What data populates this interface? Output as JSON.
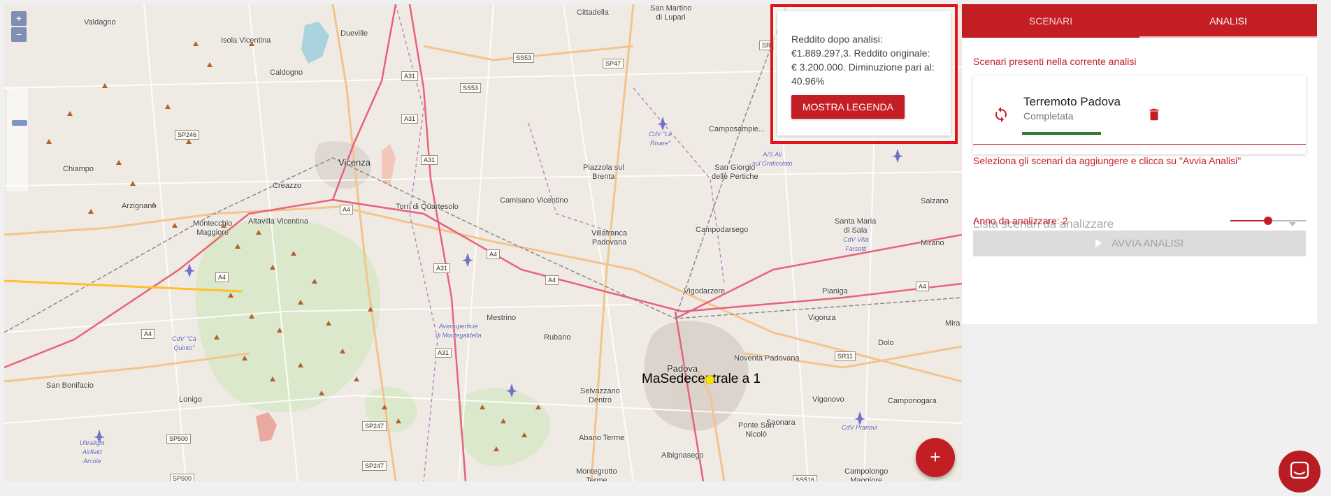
{
  "map": {
    "zoom_in": "+",
    "zoom_out": "−",
    "places": [
      {
        "id": "valdagno",
        "label": "Valdagno"
      },
      {
        "id": "isola-vicentina",
        "label": "Isola Vicentina"
      },
      {
        "id": "dueville",
        "label": "Dueville"
      },
      {
        "id": "caldogno",
        "label": "Caldogno"
      },
      {
        "id": "cittadella",
        "label": "Cittadella"
      },
      {
        "id": "san-martino",
        "label": "San Martino\ndi Lupari"
      },
      {
        "id": "chiampo",
        "label": "Chiampo"
      },
      {
        "id": "vicenza",
        "label": "Vicenza"
      },
      {
        "id": "creazzo",
        "label": "Creazzo"
      },
      {
        "id": "arzignano",
        "label": "Arzignano"
      },
      {
        "id": "montecchio",
        "label": "Montecchio\nMaggiore"
      },
      {
        "id": "altavilla",
        "label": "Altavilla Vicentina"
      },
      {
        "id": "torri",
        "label": "Torri di Quartesolo"
      },
      {
        "id": "camisano",
        "label": "Camisano Vicentino"
      },
      {
        "id": "piazzola",
        "label": "Piazzola sul\nBrenta"
      },
      {
        "id": "san-giorgio",
        "label": "San Giorgio\ndelle Pertiche"
      },
      {
        "id": "camposampiero",
        "label": "Camposampie..."
      },
      {
        "id": "villafranca",
        "label": "Villafranca\nPadovana"
      },
      {
        "id": "campodarsego",
        "label": "Campodarsego"
      },
      {
        "id": "santa-maria",
        "label": "Santa Maria\ndi Sala"
      },
      {
        "id": "salzano",
        "label": "Salzano"
      },
      {
        "id": "mirano",
        "label": "Mirano"
      },
      {
        "id": "vigodarzere",
        "label": "Vigodarzere"
      },
      {
        "id": "pianiga",
        "label": "Pianiga"
      },
      {
        "id": "mestrino",
        "label": "Mestrino"
      },
      {
        "id": "rubano",
        "label": "Rubano"
      },
      {
        "id": "vigonza",
        "label": "Vigonza"
      },
      {
        "id": "dolo",
        "label": "Dolo"
      },
      {
        "id": "mira",
        "label": "Mira"
      },
      {
        "id": "padova",
        "label": "Padova"
      },
      {
        "id": "noventa",
        "label": "Noventa Padovana"
      },
      {
        "id": "san-bonifacio",
        "label": "San Bonifacio"
      },
      {
        "id": "lonigo",
        "label": "Lonigo"
      },
      {
        "id": "selvazzano",
        "label": "Selvazzano\nDentro"
      },
      {
        "id": "vigonovo",
        "label": "Vigonovo"
      },
      {
        "id": "camponogara",
        "label": "Camponogara"
      },
      {
        "id": "saonara",
        "label": "Saonara"
      },
      {
        "id": "ponte-san-nicolo",
        "label": "Ponte San\nNicolò"
      },
      {
        "id": "abano",
        "label": "Abano Terme"
      },
      {
        "id": "albignasego",
        "label": "Albignasego"
      },
      {
        "id": "montegrotto",
        "label": "Montegrotto\nTerme"
      },
      {
        "id": "campolongo",
        "label": "Campolongo\nMaggiore"
      },
      {
        "id": "cdv-le-risare",
        "label": "CdV \"Le\nRisare\""
      },
      {
        "id": "as-ali",
        "label": "A/S Ali\nsul Graticolato"
      },
      {
        "id": "cdv-villa-farsetti",
        "label": "CdV Villa\nFarsetti"
      },
      {
        "id": "aviosuperficie",
        "label": "Aviosuperficie\ndi Montegaldella"
      },
      {
        "id": "cdv-ca-quinto",
        "label": "CdV \"Cà\nQuinto\""
      },
      {
        "id": "ultralight",
        "label": "Ultralight\nAirfield\nArcole"
      },
      {
        "id": "cdv-pranovi",
        "label": "CdV Pranovi"
      }
    ],
    "road_shields": [
      "SS53",
      "SP47",
      "A31",
      "SS53",
      "A31",
      "SP246",
      "A31",
      "A4",
      "A4",
      "A4",
      "A31",
      "A4",
      "A4",
      "A31",
      "SP247",
      "SP500",
      "SP500",
      "SP247",
      "SS516",
      "SR11",
      "A4",
      "SR"
    ],
    "overlay_label": "MaSedecentrale a 1"
  },
  "info_popup": {
    "message": "Reddito dopo analisi: €1.889.297,3. Reddito originale: € 3.200.000. Diminuzione pari al: 40.96%",
    "legend_button": "MOSTRA LEGENDA"
  },
  "fab": {
    "label": "+"
  },
  "panel": {
    "tabs": [
      {
        "label": "SCENARI",
        "active": false
      },
      {
        "label": "ANALISI",
        "active": true
      }
    ],
    "current_scenarios_label": "Scenari presenti nella corrente analisi",
    "scenario": {
      "title": "Terremoto Padova",
      "status": "Completata",
      "progress": 1.0,
      "icons": [
        "refresh-icon",
        "delete-icon"
      ]
    },
    "select_label": "Seleziona gli scenari da aggiungere e clicca su \"Avvia Analisi\"",
    "select_placeholder": "Lista scenari da analizzare",
    "year_label": "Anno da analizzare: 2",
    "year_slider_fraction": 0.5,
    "run_button": "AVVIA ANALISI"
  },
  "colors": {
    "accent": "#c41e25",
    "highlight_border": "#e2131b",
    "progress": "#2e7d32",
    "disabled_button": "#dcdcdc"
  },
  "chat": {
    "icon": "chat-icon"
  }
}
